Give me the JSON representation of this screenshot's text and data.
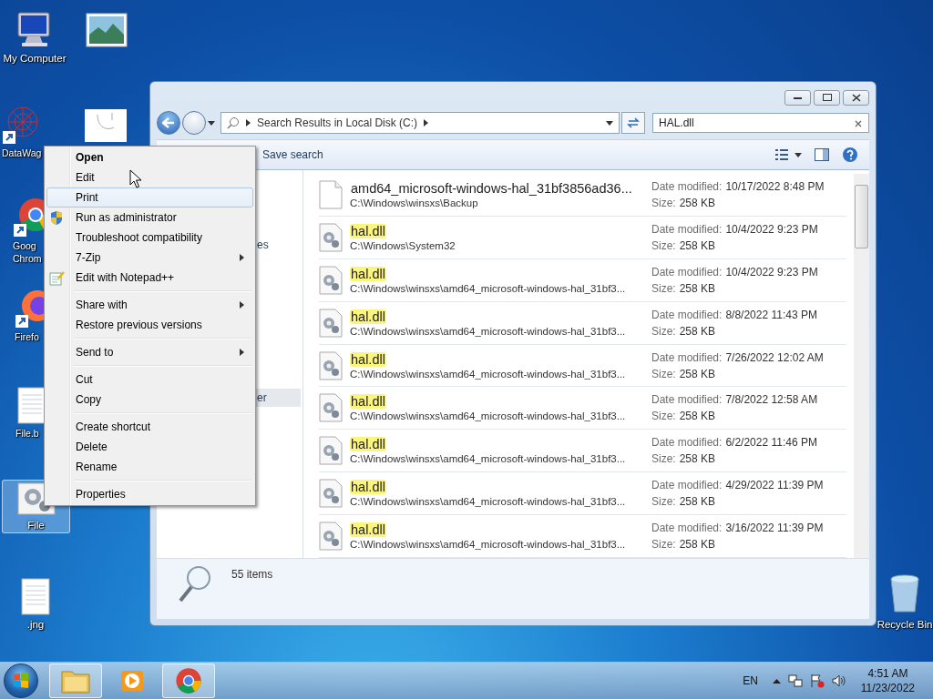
{
  "desktop_icons": [
    {
      "kind": "computer",
      "label": "My Computer",
      "selected": false
    },
    {
      "kind": "picture",
      "selected": false
    },
    {
      "kind": "network",
      "label": "DataWag",
      "selected": false
    },
    {
      "kind": "sketch",
      "selected": false
    },
    {
      "kind": "chrome",
      "label": "Goog Chrom",
      "selected": false
    },
    {
      "kind": "firefox",
      "label": "Firefo",
      "selected": false
    },
    {
      "kind": "text",
      "label": "File.b",
      "selected": false
    },
    {
      "kind": "gears",
      "label": "File",
      "selected": true
    },
    {
      "kind": "text",
      "label": ".jng",
      "selected": false
    },
    {
      "kind": "recycle",
      "label": "Recycle Bin",
      "selected": false
    }
  ],
  "explorer": {
    "address": "Search Results in Local Disk (C:)",
    "search": {
      "value": "HAL.dll"
    },
    "toolbar": {
      "save_search": "Save search"
    },
    "nav": [
      {
        "label": "es",
        "selected": false
      },
      {
        "label": "er",
        "selected": true
      }
    ],
    "results": [
      {
        "kind": "blank",
        "name": "amd64_microsoft-windows-hal_31bf3856ad36...",
        "highlight": false,
        "path": "C:\\Windows\\winsxs\\Backup",
        "date_label": "Date modified:",
        "date": "10/17/2022 8:48 PM",
        "size_label": "Size:",
        "size": "258 KB"
      },
      {
        "kind": "system",
        "name": "hal.dll",
        "highlight": true,
        "path": "C:\\Windows\\System32",
        "date_label": "Date modified:",
        "date": "10/4/2022 9:23 PM",
        "size_label": "Size:",
        "size": "258 KB"
      },
      {
        "kind": "system",
        "name": "hal.dll",
        "highlight": true,
        "path": "C:\\Windows\\winsxs\\amd64_microsoft-windows-hal_31bf3...",
        "date_label": "Date modified:",
        "date": "10/4/2022 9:23 PM",
        "size_label": "Size:",
        "size": "258 KB"
      },
      {
        "kind": "system",
        "name": "hal.dll",
        "highlight": true,
        "path": "C:\\Windows\\winsxs\\amd64_microsoft-windows-hal_31bf3...",
        "date_label": "Date modified:",
        "date": "8/8/2022 11:43 PM",
        "size_label": "Size:",
        "size": "258 KB"
      },
      {
        "kind": "system",
        "name": "hal.dll",
        "highlight": true,
        "path": "C:\\Windows\\winsxs\\amd64_microsoft-windows-hal_31bf3...",
        "date_label": "Date modified:",
        "date": "7/26/2022 12:02 AM",
        "size_label": "Size:",
        "size": "258 KB"
      },
      {
        "kind": "system",
        "name": "hal.dll",
        "highlight": true,
        "path": "C:\\Windows\\winsxs\\amd64_microsoft-windows-hal_31bf3...",
        "date_label": "Date modified:",
        "date": "7/8/2022 12:58 AM",
        "size_label": "Size:",
        "size": "258 KB"
      },
      {
        "kind": "system",
        "name": "hal.dll",
        "highlight": true,
        "path": "C:\\Windows\\winsxs\\amd64_microsoft-windows-hal_31bf3...",
        "date_label": "Date modified:",
        "date": "6/2/2022 11:46 PM",
        "size_label": "Size:",
        "size": "258 KB"
      },
      {
        "kind": "system",
        "name": "hal.dll",
        "highlight": true,
        "path": "C:\\Windows\\winsxs\\amd64_microsoft-windows-hal_31bf3...",
        "date_label": "Date modified:",
        "date": "4/29/2022 11:39 PM",
        "size_label": "Size:",
        "size": "258 KB"
      },
      {
        "kind": "system",
        "name": "hal.dll",
        "highlight": true,
        "path": "C:\\Windows\\winsxs\\amd64_microsoft-windows-hal_31bf3...",
        "date_label": "Date modified:",
        "date": "3/16/2022 11:39 PM",
        "size_label": "Size:",
        "size": "258 KB"
      }
    ],
    "status": "55 items"
  },
  "context_menu": [
    {
      "kind": "item",
      "label": "Open",
      "bold": true,
      "selected": false,
      "submenu": false
    },
    {
      "kind": "item",
      "label": "Edit",
      "bold": false,
      "selected": false,
      "submenu": false
    },
    {
      "kind": "item",
      "label": "Print",
      "bold": false,
      "selected": true,
      "submenu": false
    },
    {
      "kind": "admin-item",
      "label": "Run as administrator",
      "bold": false,
      "selected": false,
      "submenu": false
    },
    {
      "kind": "item",
      "label": "Troubleshoot compatibility",
      "bold": false,
      "selected": false,
      "submenu": false
    },
    {
      "kind": "item",
      "label": "7-Zip",
      "bold": false,
      "selected": false,
      "submenu": true
    },
    {
      "kind": "notepad-item",
      "label": "Edit with Notepad++",
      "bold": false,
      "selected": false,
      "submenu": false
    },
    {
      "kind": "separator"
    },
    {
      "kind": "item",
      "label": "Share with",
      "bold": false,
      "selected": false,
      "submenu": true
    },
    {
      "kind": "item",
      "label": "Restore previous versions",
      "bold": false,
      "selected": false,
      "submenu": false
    },
    {
      "kind": "separator"
    },
    {
      "kind": "item",
      "label": "Send to",
      "bold": false,
      "selected": false,
      "submenu": true
    },
    {
      "kind": "separator"
    },
    {
      "kind": "item",
      "label": "Cut",
      "bold": false,
      "selected": false,
      "submenu": false
    },
    {
      "kind": "item",
      "label": "Copy",
      "bold": false,
      "selected": false,
      "submenu": false
    },
    {
      "kind": "separator"
    },
    {
      "kind": "item",
      "label": "Create shortcut",
      "bold": false,
      "selected": false,
      "submenu": false
    },
    {
      "kind": "item",
      "label": "Delete",
      "bold": false,
      "selected": false,
      "submenu": false
    },
    {
      "kind": "item",
      "label": "Rename",
      "bold": false,
      "selected": false,
      "submenu": false
    },
    {
      "kind": "separator"
    },
    {
      "kind": "item",
      "label": "Properties",
      "bold": false,
      "selected": false,
      "submenu": false
    }
  ],
  "taskbar": {
    "apps": [
      {
        "kind": "explorer",
        "active": true
      },
      {
        "kind": "media",
        "active": false
      },
      {
        "kind": "chrome",
        "active": true
      }
    ],
    "language": "EN",
    "time": "4:51 AM",
    "date": "11/23/2022"
  }
}
